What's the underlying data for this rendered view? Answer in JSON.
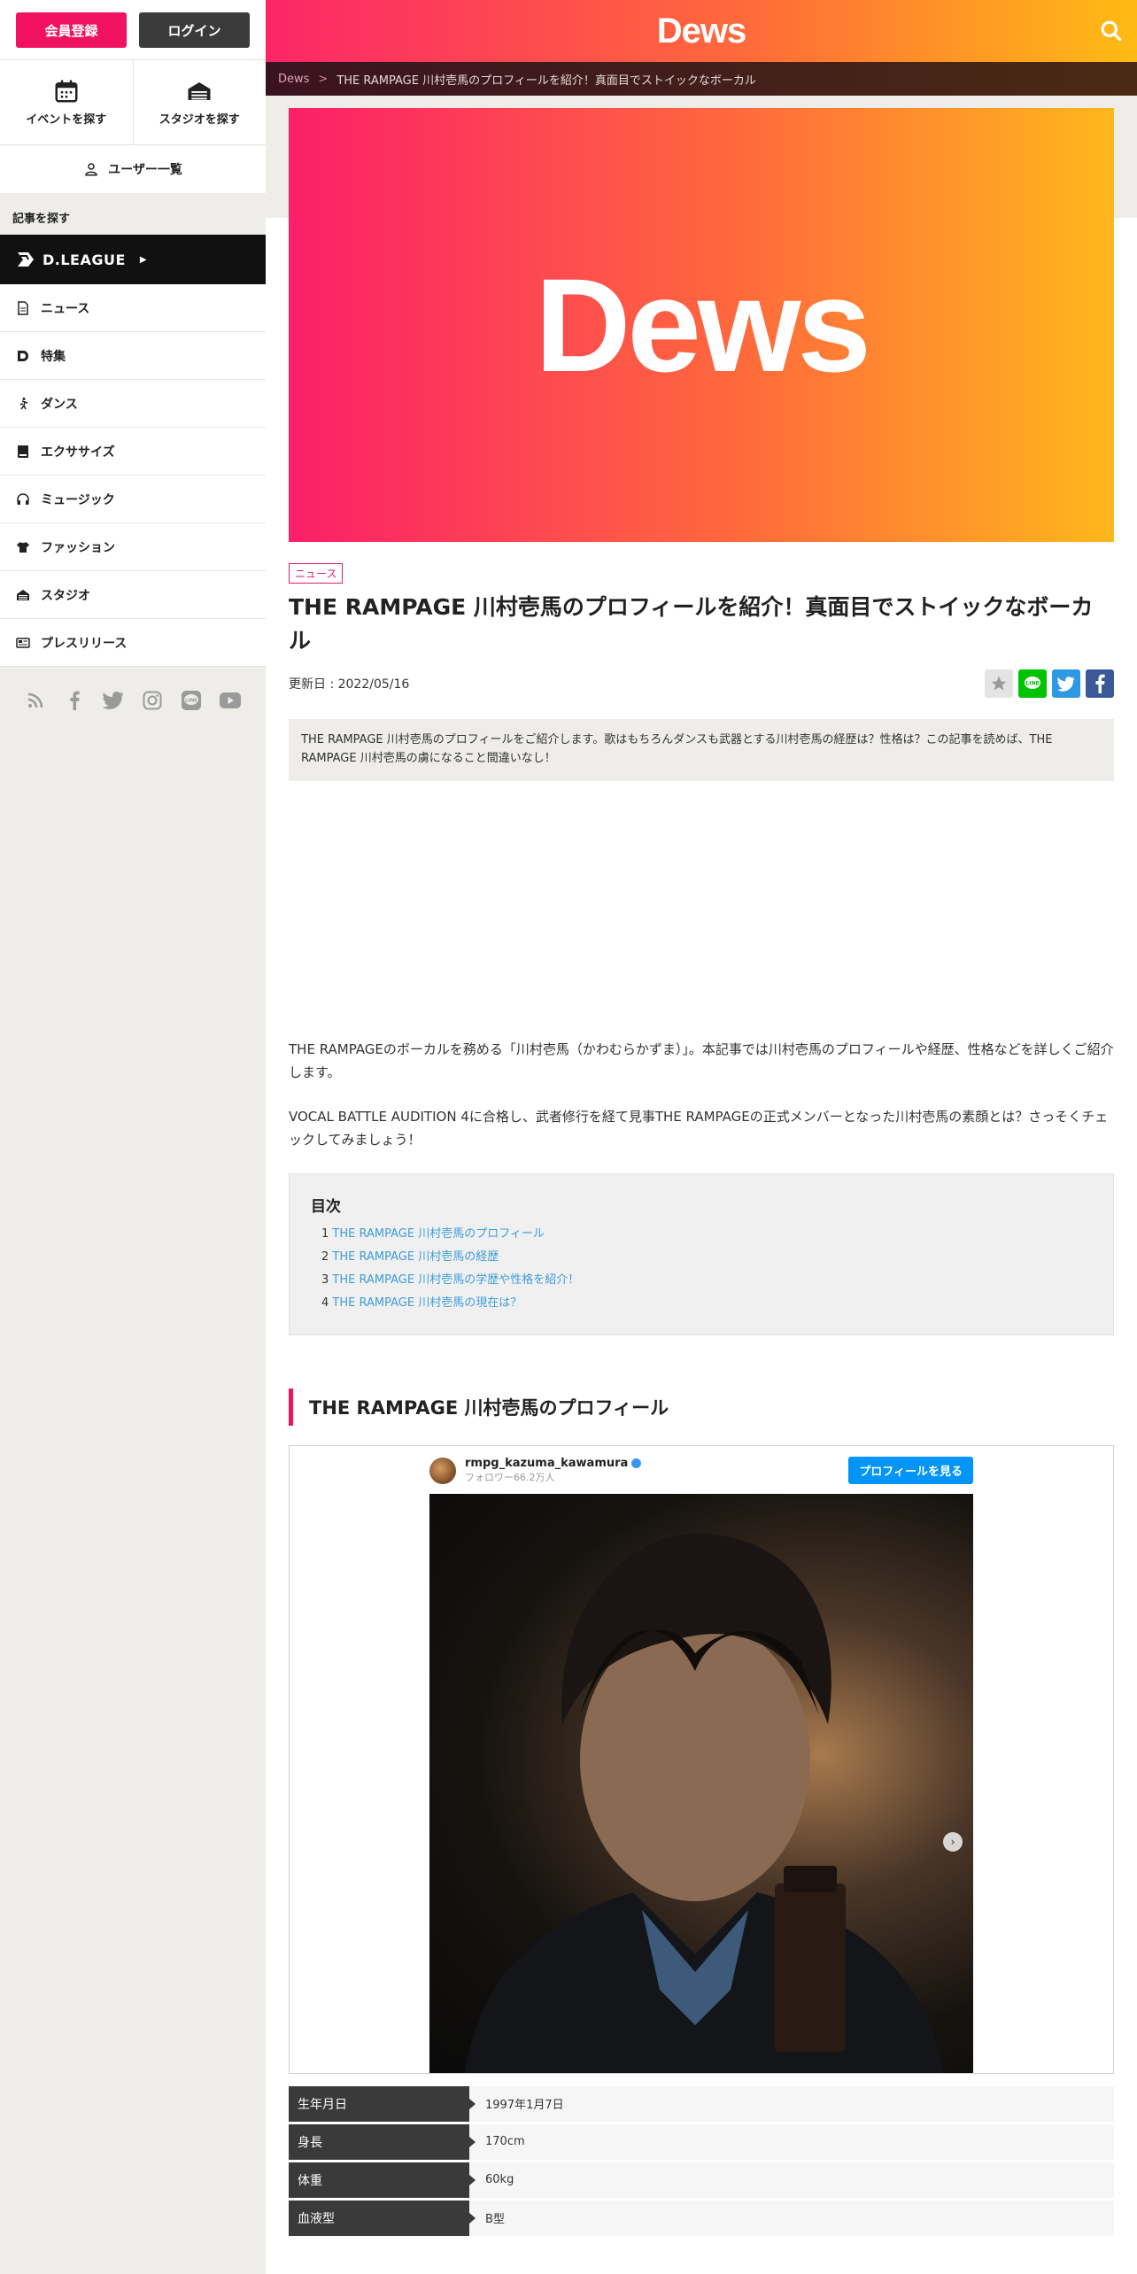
{
  "sidebar": {
    "register": "会員登録",
    "login": "ログイン",
    "find_events": "イベントを探す",
    "find_studios": "スタジオを探す",
    "users": "ユーザー一覧",
    "section_label": "記事を探す",
    "dleague": "D.LEAGUE",
    "items": [
      {
        "label": "ニュース",
        "icon": "document-icon"
      },
      {
        "label": "特集",
        "icon": "dews-d-icon"
      },
      {
        "label": "ダンス",
        "icon": "running-icon"
      },
      {
        "label": "エクササイズ",
        "icon": "book-icon"
      },
      {
        "label": "ミュージック",
        "icon": "headphones-icon"
      },
      {
        "label": "ファッション",
        "icon": "tshirt-icon"
      },
      {
        "label": "スタジオ",
        "icon": "studio-icon"
      },
      {
        "label": "プレスリリース",
        "icon": "newspaper-icon"
      }
    ],
    "socials": [
      "rss-icon",
      "facebook-icon",
      "twitter-icon",
      "instagram-icon",
      "line-icon",
      "youtube-icon"
    ]
  },
  "header": {
    "logo": "Dews",
    "breadcrumb_home": "Dews",
    "breadcrumb_sep": ">",
    "breadcrumb_current": "THE RAMPAGE 川村壱馬のプロフィールを紹介！真面目でストイックなボーカル"
  },
  "hero": {
    "logo": "Dews"
  },
  "article": {
    "category": "ニュース",
    "title": "THE RAMPAGE 川村壱馬のプロフィールを紹介！真面目でストイックなボーカル",
    "updated": "更新日 : 2022/05/16",
    "lead": "THE RAMPAGE 川村壱馬のプロフィールをご紹介します。歌はもちろんダンスも武器とする川村壱馬の経歴は？性格は？この記事を読めば、THE RAMPAGE 川村壱馬の虜になること間違いなし！",
    "para1": "THE RAMPAGEのボーカルを務める「川村壱馬（かわむらかずま）」。本記事では川村壱馬のプロフィールや経歴、性格などを詳しくご紹介します。",
    "para2": "VOCAL BATTLE AUDITION 4に合格し、武者修行を経て見事THE RAMPAGEの正式メンバーとなった川村壱馬の素顔とは？さっそくチェックしてみましょう！",
    "toc_title": "目次",
    "toc": [
      {
        "num": "1",
        "text": "THE RAMPAGE 川村壱馬のプロフィール"
      },
      {
        "num": "2",
        "text": "THE RAMPAGE 川村壱馬の経歴"
      },
      {
        "num": "3",
        "text": "THE RAMPAGE 川村壱馬の学歴や性格を紹介！"
      },
      {
        "num": "4",
        "text": "THE RAMPAGE 川村壱馬の現在は？"
      }
    ],
    "h2_profile": "THE RAMPAGE 川村壱馬のプロフィール",
    "instagram": {
      "username": "rmpg_kazuma_kawamura",
      "followers": "フォロワー66.2万人",
      "button": "プロフィールを見る"
    },
    "profile": [
      {
        "key": "生年月日",
        "value": "1997年1月7日"
      },
      {
        "key": "身長",
        "value": "170cm"
      },
      {
        "key": "体重",
        "value": "60kg"
      },
      {
        "key": "血液型",
        "value": "B型"
      }
    ]
  },
  "colors": {
    "accent": "#f0125e",
    "link": "#3d9dda"
  }
}
